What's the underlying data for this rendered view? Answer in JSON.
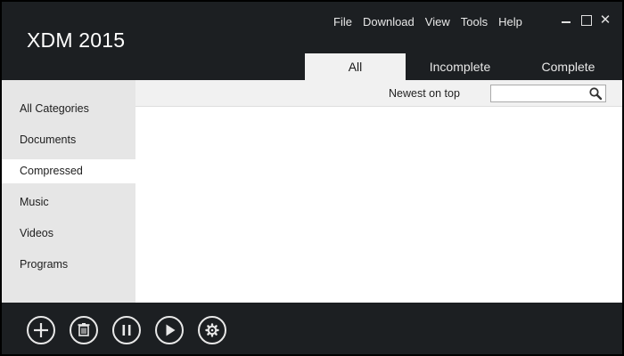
{
  "app": {
    "title": "XDM 2015"
  },
  "menu": {
    "items": [
      "File",
      "Download",
      "View",
      "Tools",
      "Help"
    ]
  },
  "tabs": [
    "All",
    "Incomplete",
    "Complete"
  ],
  "sidebar": {
    "items": [
      "All Categories",
      "Documents",
      "Compressed",
      "Music",
      "Videos",
      "Programs"
    ],
    "selected": "Compressed"
  },
  "toolbar": {
    "sort_label": "Newest on top",
    "search_value": ""
  },
  "actions": [
    "add-icon",
    "delete-icon",
    "pause-icon",
    "resume-icon",
    "settings-icon"
  ],
  "colors": {
    "header_bg": "#1c1f22",
    "sidebar_bg": "#e6e6e6",
    "active_tab_bg": "#f1f1f1",
    "selected_item_bg": "#ffffff"
  }
}
